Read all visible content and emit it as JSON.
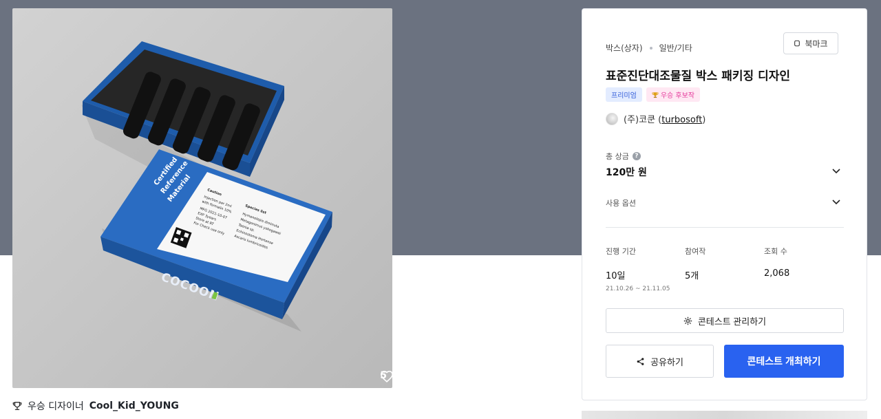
{
  "gallery": {
    "likes_count": "5",
    "winner_prefix": "우승 디자이너",
    "winner_name": "Cool_Kid_YOUNG",
    "box_lid_text": [
      "Certified",
      "Reference",
      "Material"
    ],
    "box_brand": "COCOON",
    "label_caution": "Caution",
    "label_species_title": "Species list",
    "label_species": [
      "Hymenolepis diminuta",
      "Metagonimus yokogawai",
      "Taenia sp.",
      "Echinostoma Hortense",
      "Ascaris lumbricoides"
    ],
    "label_notes": [
      "Injection per 2ml",
      "with formalin 10%",
      "MFG 2021-10-07",
      "EXP 3years",
      "Store at RT",
      "For Check use only"
    ]
  },
  "contest": {
    "category": "박스(상자)",
    "subcategory": "일반/기타",
    "bookmark_label": "북마크",
    "title": "표준진단대조물질 박스 패키징 디자인",
    "badges": {
      "premium": "프리미엄",
      "award": "우승 후보작"
    },
    "company_name": "(주)코쿤 (",
    "company_handle": "turbosoft",
    "company_close": ")",
    "prize_label": "총 상금",
    "prize_value": "120만 원",
    "usage_label": "사용 옵션",
    "stats": {
      "duration_label": "진행 기간",
      "duration_value": "10일",
      "duration_range": "21.10.26 ~ 21.11.05",
      "entries_label": "참여작",
      "entries_value": "5개",
      "views_label": "조회 수",
      "views_value": "2,068"
    },
    "manage_button": "콘테스트 관리하기",
    "share_button": "공유하기",
    "host_button": "콘테스트 개최하기"
  },
  "colors": {
    "band": "#6b7280",
    "primary": "#2962f0",
    "box_blue": "#1f5fb0"
  },
  "icons": [
    "heart-icon",
    "trophy-icon",
    "bookmark-icon",
    "help-icon",
    "chevron-down-icon",
    "gear-icon",
    "share-icon"
  ]
}
